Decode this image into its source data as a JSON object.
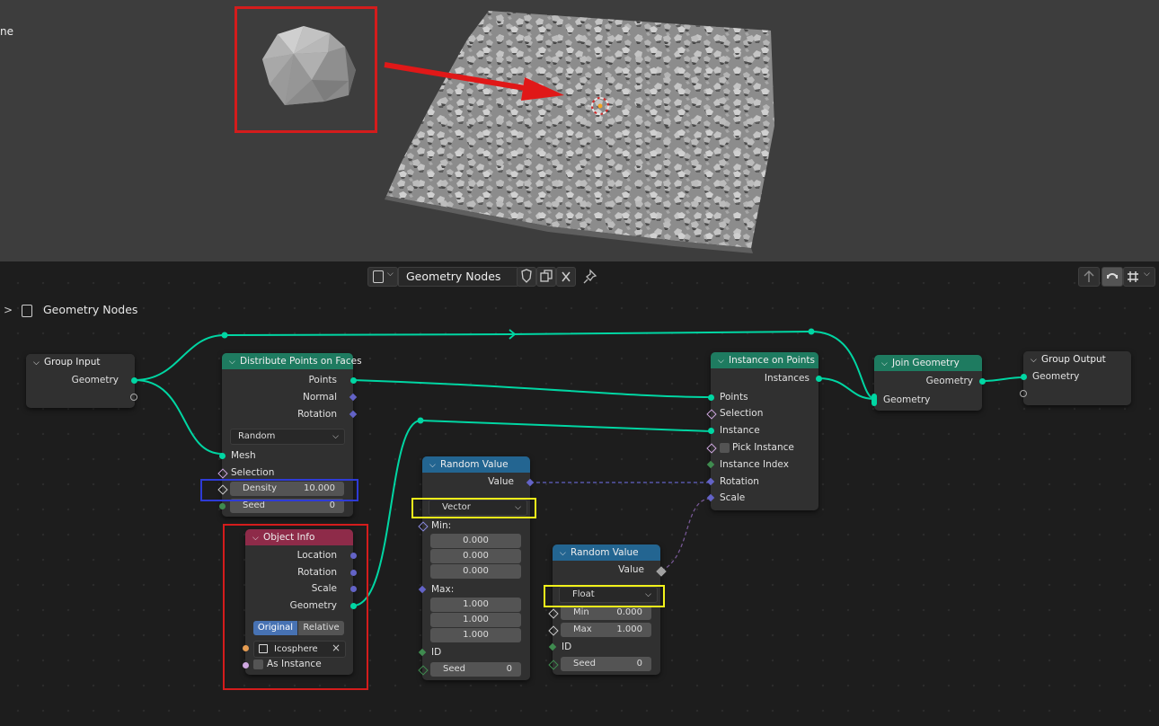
{
  "viewport": {
    "partial_label": "ne"
  },
  "header": {
    "node_tree_name": "Geometry Nodes",
    "breadcrumb_label": "Geometry Nodes"
  },
  "nodes": {
    "group_input": {
      "title": "Group Input",
      "geometry": "Geometry"
    },
    "distribute": {
      "title": "Distribute Points on Faces",
      "points": "Points",
      "normal": "Normal",
      "rotation": "Rotation",
      "mode": "Random",
      "mesh": "Mesh",
      "selection": "Selection",
      "density_label": "Density",
      "density_value": "10.000",
      "seed_label": "Seed",
      "seed_value": "0"
    },
    "object_info": {
      "title": "Object Info",
      "location": "Location",
      "rotation": "Rotation",
      "scale": "Scale",
      "geometry": "Geometry",
      "original": "Original",
      "relative": "Relative",
      "object": "Icosphere",
      "as_instance": "As Instance"
    },
    "random_vector": {
      "title": "Random Value",
      "value": "Value",
      "type": "Vector",
      "min_label": "Min:",
      "min": [
        "0.000",
        "0.000",
        "0.000"
      ],
      "max_label": "Max:",
      "max": [
        "1.000",
        "1.000",
        "1.000"
      ],
      "id": "ID",
      "seed_label": "Seed",
      "seed_value": "0"
    },
    "random_float": {
      "title": "Random Value",
      "value": "Value",
      "type": "Float",
      "min_label": "Min",
      "min_value": "0.000",
      "max_label": "Max",
      "max_value": "1.000",
      "id": "ID",
      "seed_label": "Seed",
      "seed_value": "0"
    },
    "instance_on_points": {
      "title": "Instance on Points",
      "instances": "Instances",
      "points": "Points",
      "selection": "Selection",
      "instance": "Instance",
      "pick_instance": "Pick Instance",
      "instance_index": "Instance Index",
      "rotation": "Rotation",
      "scale": "Scale"
    },
    "join_geometry": {
      "title": "Join Geometry",
      "geometry_out": "Geometry",
      "geometry_in": "Geometry"
    },
    "group_output": {
      "title": "Group Output",
      "geometry": "Geometry"
    }
  },
  "colors": {
    "geometry_socket": "#00d6a3",
    "vector_socket": "#6363c7",
    "geometry_header": "#1e7b60",
    "utility_header": "#236591",
    "input_header": "#8e2b49",
    "highlight_red": "#d41c1c",
    "highlight_blue": "#2e3bd6",
    "highlight_yellow": "#f2f21a"
  }
}
